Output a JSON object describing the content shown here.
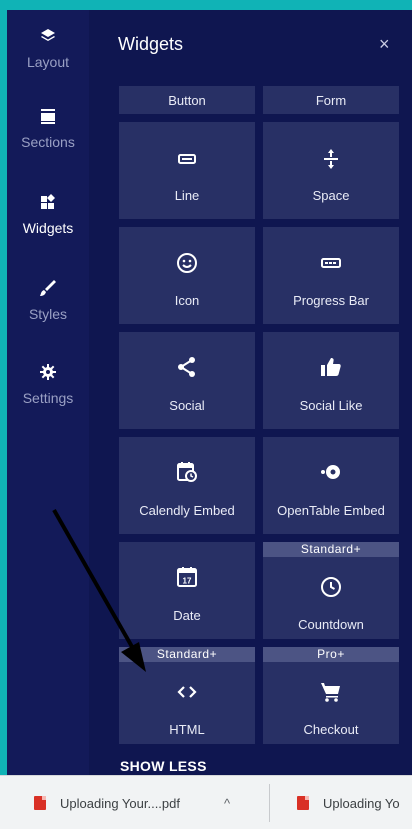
{
  "rail": {
    "items": [
      {
        "label": "Layout",
        "icon": "layers-icon"
      },
      {
        "label": "Sections",
        "icon": "sections-icon"
      },
      {
        "label": "Widgets",
        "icon": "widgets-icon",
        "active": true
      },
      {
        "label": "Styles",
        "icon": "brush-icon"
      },
      {
        "label": "Settings",
        "icon": "gear-icon"
      }
    ]
  },
  "panel": {
    "title": "Widgets",
    "close_symbol": "×",
    "show_less": "SHOW LESS"
  },
  "widgets": [
    {
      "label": "Button",
      "icon": "none"
    },
    {
      "label": "Form",
      "icon": "none"
    },
    {
      "label": "Line",
      "icon": "line-icon"
    },
    {
      "label": "Space",
      "icon": "space-icon"
    },
    {
      "label": "Icon",
      "icon": "smiley-icon"
    },
    {
      "label": "Progress Bar",
      "icon": "progress-bar-icon"
    },
    {
      "label": "Social",
      "icon": "share-icon"
    },
    {
      "label": "Social Like",
      "icon": "thumbs-up-icon"
    },
    {
      "label": "Calendly Embed",
      "icon": "calendar-clock-icon"
    },
    {
      "label": "OpenTable Embed",
      "icon": "opentable-icon"
    },
    {
      "label": "Date",
      "icon": "calendar-17-icon",
      "day": "17"
    },
    {
      "label": "Countdown",
      "icon": "clock-icon",
      "badge": "Standard+"
    },
    {
      "label": "HTML",
      "icon": "code-icon",
      "badge": "Standard+"
    },
    {
      "label": "Checkout",
      "icon": "cart-icon",
      "badge": "Pro+"
    }
  ],
  "downloads": {
    "items": [
      {
        "name": "Uploading Your....pdf",
        "chevron": "^"
      },
      {
        "name": "Uploading Yo"
      }
    ]
  },
  "colors": {
    "background": "#10b3b6",
    "panel": "#0f1650",
    "tile": "#283065",
    "badge": "#4c5484"
  }
}
